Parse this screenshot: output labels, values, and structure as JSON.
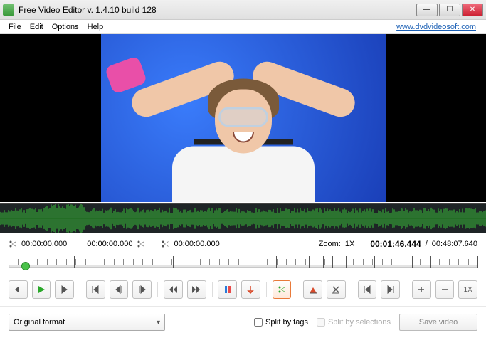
{
  "window": {
    "title": "Free Video Editor v. 1.4.10 build 128"
  },
  "menu": {
    "file": "File",
    "edit": "Edit",
    "options": "Options",
    "help": "Help",
    "link": "www.dvdvideosoft.com"
  },
  "times": {
    "t1": "00:00:00.000",
    "t2": "00:00:00.000",
    "t3": "00:00:00.000",
    "zoom_label": "Zoom:",
    "zoom_value": "1X",
    "current": "00:01:46.444",
    "sep": "/",
    "duration": "00:48:07.640"
  },
  "buttons": {
    "zoom_text": "1X"
  },
  "bottom": {
    "format": "Original format",
    "split_tags": "Split by tags",
    "split_sel": "Split by selections",
    "save": "Save video"
  },
  "playhead_pct": 3.7,
  "ticks_major_pct": [
    0,
    14,
    35,
    57,
    64,
    67,
    69,
    72,
    78,
    86,
    90,
    100
  ],
  "ticks_minor_count": 50
}
